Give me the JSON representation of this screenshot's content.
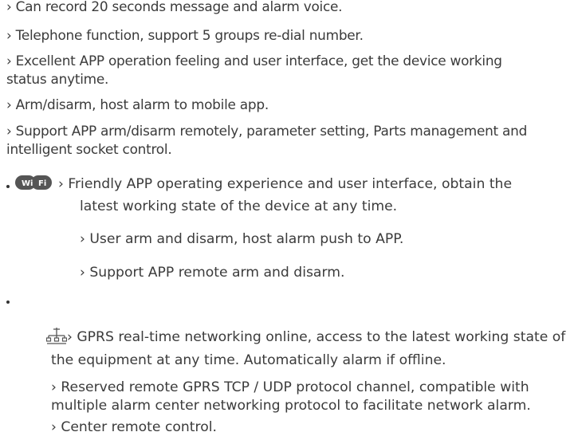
{
  "top_section": {
    "l1": "› Can record 20 seconds message and alarm voice.",
    "l2": "› Telephone function, support 5 groups re-dial number.",
    "l3a": "› Excellent APP operation feeling and user interface, get the device  working",
    "l3b": "status anytime.",
    "l4": "› Arm/disarm, host alarm to mobile app.",
    "l5a": "› Support APP arm/disarm remotely, parameter setting, Parts management and",
    "l5b": "intelligent socket control."
  },
  "wifi_section": {
    "icon": "wifi-icon",
    "l1a": "› Friendly APP operating experience and user interface, obtain the",
    "l1b": "latest working state of the device at any time.",
    "l2": "› User arm and disarm, host alarm push to APP.",
    "l3": "› Support APP remote arm and disarm."
  },
  "gprs_section": {
    "icon": "network-icon",
    "l1a": "› GPRS real-time networking online, access to the latest working state of",
    "l1b": "the equipment at any time. Automatically alarm if offline.",
    "l2a": "› Reserved remote GPRS TCP / UDP protocol channel, compatible with",
    "l2b": "multiple alarm center networking protocol to facilitate network alarm.",
    "l3": "› Center remote control."
  }
}
